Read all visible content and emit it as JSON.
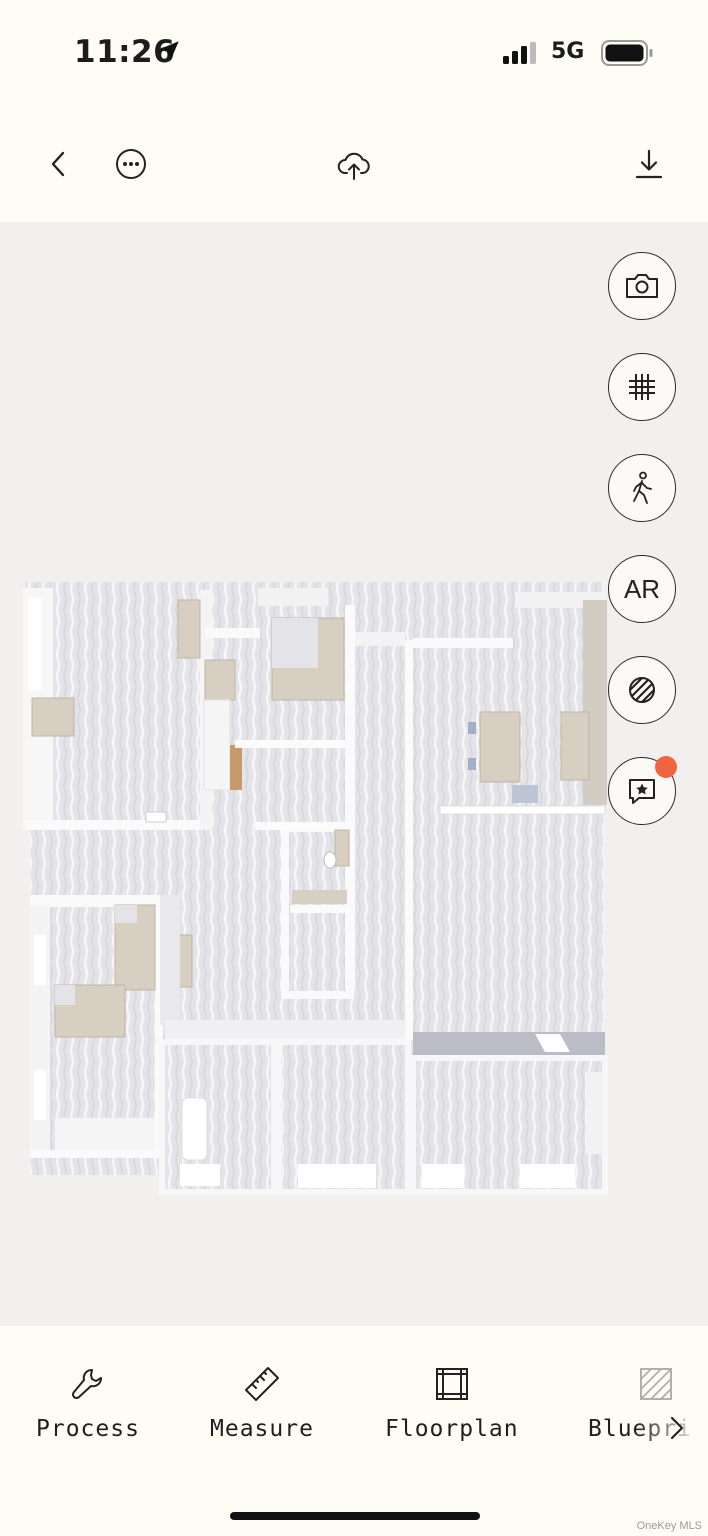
{
  "status_bar": {
    "time": "11:26",
    "network": "5G",
    "icons": [
      "location-arrow-icon",
      "cell-signal-icon",
      "battery-icon"
    ]
  },
  "toolbar": {
    "icons": [
      "back-chevron-icon",
      "more-options-icon",
      "upload-cloud-icon",
      "download-icon"
    ]
  },
  "side_tools": {
    "ar_label": "AR",
    "icons": [
      "camera-icon",
      "grid-icon",
      "walk-icon",
      "ar-icon",
      "texture-icon",
      "annotation-star-icon"
    ],
    "annotation_badge_color": "#f0653e"
  },
  "bottom_tabs": [
    {
      "label": "Process",
      "icon": "wrench-icon"
    },
    {
      "label": "Measure",
      "icon": "ruler-icon"
    },
    {
      "label": "Floorplan",
      "icon": "floorplan-icon"
    },
    {
      "label": "Bluepri",
      "icon": "blueprint-icon"
    }
  ],
  "watermark": "OneKey MLS",
  "colors": {
    "background": "#fdfdf5",
    "viewport": "#f1f0ee",
    "floor": "#e3e2e6",
    "furniture": "#d7cfc2",
    "accent": "#f0653e"
  }
}
